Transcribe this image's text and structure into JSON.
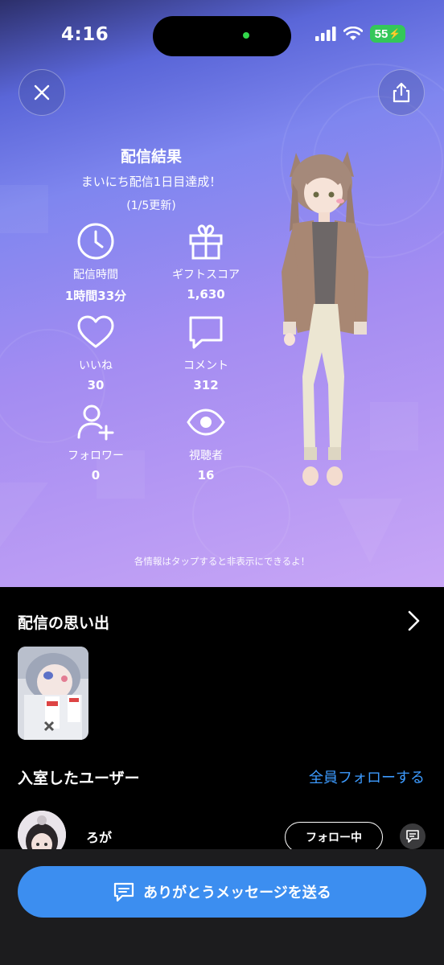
{
  "status_bar": {
    "time": "4:16",
    "battery": "55"
  },
  "result": {
    "title": "配信結果",
    "achievement": "まいにち配信1日目達成！",
    "update": "(1/5更新)"
  },
  "stats": [
    {
      "icon": "clock-icon",
      "label": "配信時間",
      "value": "1時間33分"
    },
    {
      "icon": "gift-icon",
      "label": "ギフトスコア",
      "value": "1,630"
    },
    {
      "icon": "heart-icon",
      "label": "いいね",
      "value": "30"
    },
    {
      "icon": "comment-icon",
      "label": "コメント",
      "value": "312"
    },
    {
      "icon": "add-user-icon",
      "label": "フォロワー",
      "value": "0"
    },
    {
      "icon": "eye-icon",
      "label": "視聴者",
      "value": "16"
    }
  ],
  "hint": "各情報はタップすると非表示にできるよ！",
  "memories": {
    "title": "配信の思い出"
  },
  "users": {
    "title": "入室したユーザー",
    "follow_all": "全員フォローする",
    "list": [
      {
        "name": "ろが",
        "follow_state": "フォロー中"
      }
    ]
  },
  "thanks_button": "ありがとうメッセージを送る",
  "colors": {
    "accent": "#3c8ef0",
    "link": "#3d9bff",
    "battery": "#34c759"
  }
}
